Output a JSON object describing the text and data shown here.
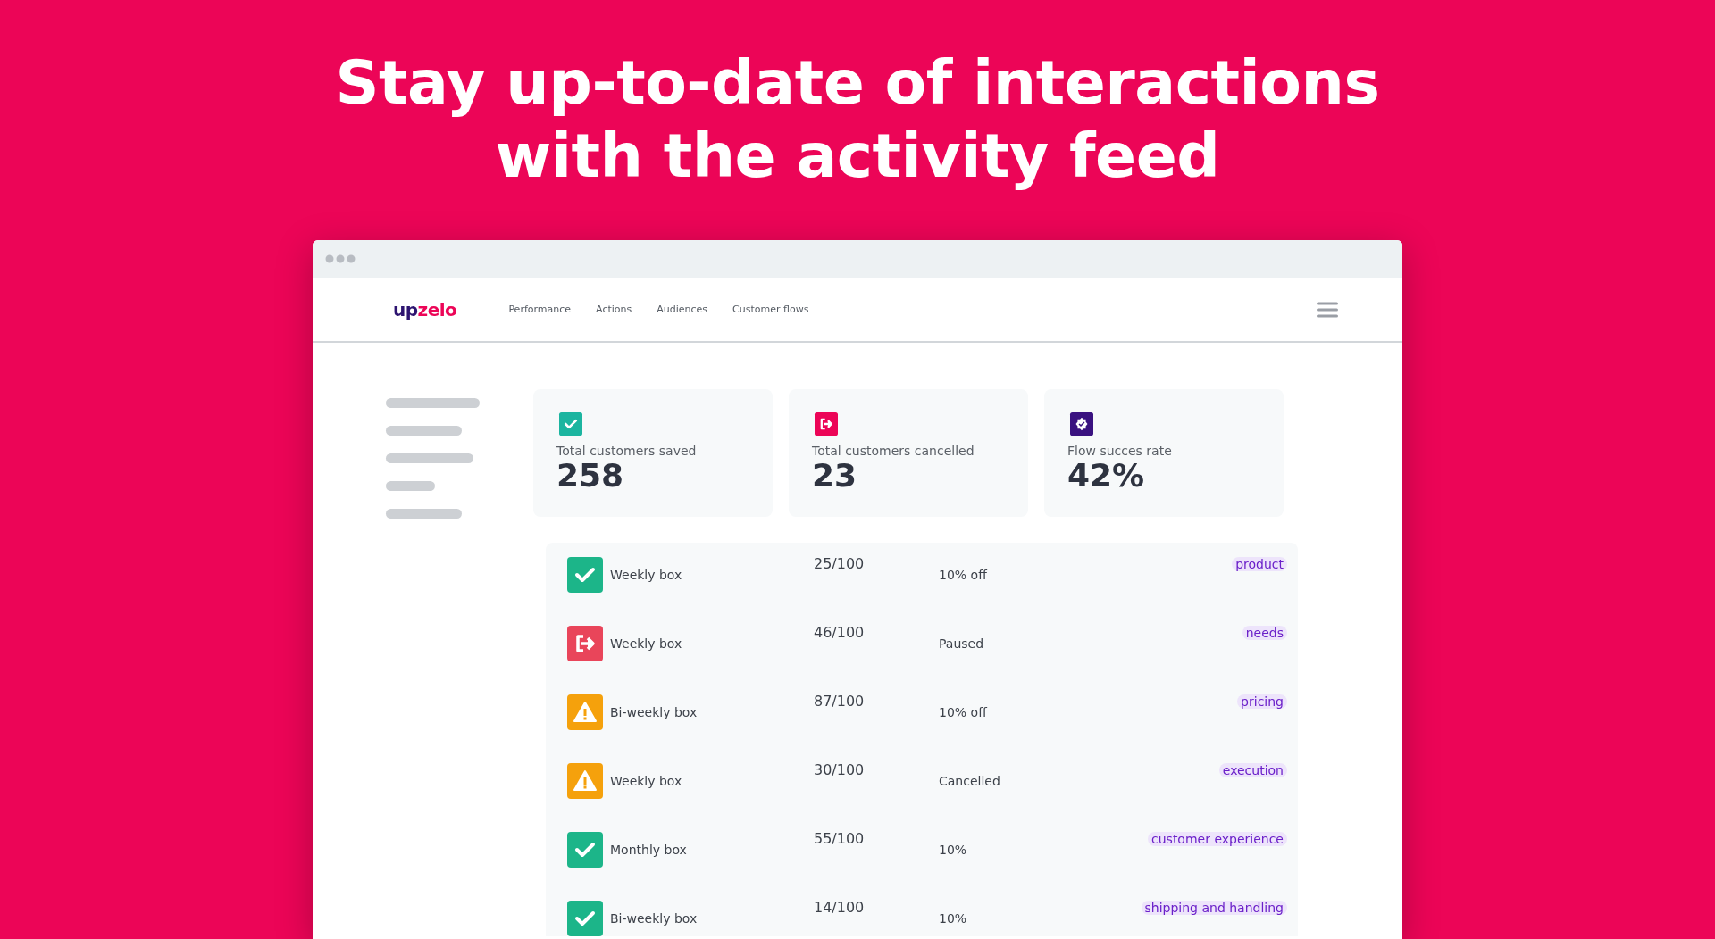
{
  "headline": [
    "Stay up-to-date of interactions",
    "with the activity feed"
  ],
  "nav": {
    "logo": {
      "part1": "up",
      "part2": "zelo"
    },
    "items": [
      "Performance",
      "Actions",
      "Audiences",
      "Customer flows"
    ]
  },
  "stats": [
    {
      "kind": "saved",
      "label": "Total customers saved",
      "value": "258"
    },
    {
      "kind": "cancelled",
      "label": "Total customers cancelled",
      "value": "23"
    },
    {
      "kind": "rate",
      "label": "Flow succes rate",
      "value": "42%"
    }
  ],
  "feed": [
    {
      "kind": "saved",
      "name": "Weekly box",
      "score": "25/100",
      "status": "10% off",
      "tag": "product"
    },
    {
      "kind": "cancelled",
      "name": "Weekly box",
      "score": "46/100",
      "status": "Paused",
      "tag": "needs"
    },
    {
      "kind": "warning",
      "name": "Bi-weekly box",
      "score": "87/100",
      "status": "10% off",
      "tag": "pricing"
    },
    {
      "kind": "warning",
      "name": "Weekly box",
      "score": "30/100",
      "status": "Cancelled",
      "tag": "execution"
    },
    {
      "kind": "saved",
      "name": "Monthly box",
      "score": "55/100",
      "status": "10%",
      "tag": "customer experience"
    },
    {
      "kind": "saved",
      "name": "Bi-weekly box",
      "score": "14/100",
      "status": "10%",
      "tag": "shipping and handling"
    }
  ]
}
